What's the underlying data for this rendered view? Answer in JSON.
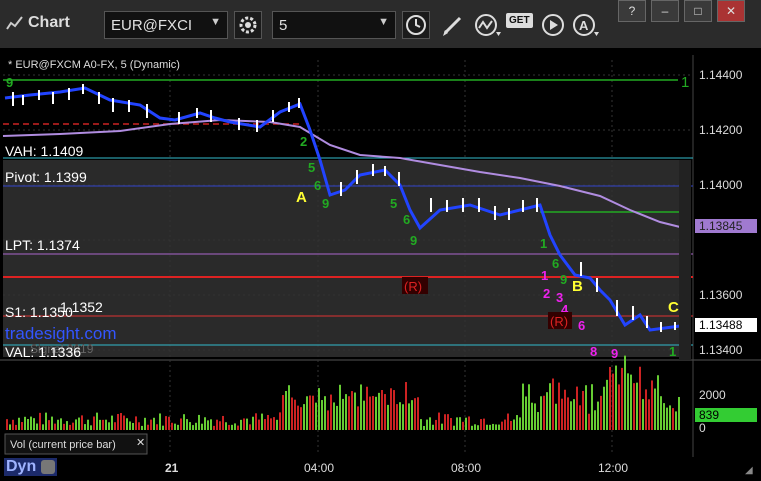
{
  "window": {
    "title": "Chart",
    "symbol": "EUR@FXCI",
    "interval": "5",
    "get_label": "GET",
    "win_buttons": [
      "?",
      "–",
      "□",
      "✕"
    ]
  },
  "chart": {
    "caption": "* EUR@FXCM A0-FX, 5 (Dynamic)",
    "date_label": "21",
    "time_labels": [
      "04:00",
      "08:00",
      "12:00"
    ],
    "price_ticks": [
      "1.14400",
      "1.14200",
      "1.14000",
      "1.13600",
      "1.13400"
    ],
    "current_price": "1.13488",
    "line_price": "1.13845",
    "level_labels": {
      "vah": "VAH: 1.1409",
      "pivot": "Pivot: 1.1399",
      "lpt": "LPT: 1.1374",
      "s1": "S1: 1.1350",
      "val": "VAL: 1.1336",
      "hidden": "1.1352",
      "brand": "tradesight.com",
      "faint": "Signal 2019"
    },
    "markers": {
      "A": "A",
      "B": "B",
      "C": "C",
      "R": "(R)",
      "one_green": "1",
      "one_red": "1"
    },
    "volume": {
      "title": "Vol (current price bar)",
      "tick": "2000",
      "zero": "0",
      "current": "839"
    }
  },
  "status": {
    "dyn": "Dyn"
  }
}
